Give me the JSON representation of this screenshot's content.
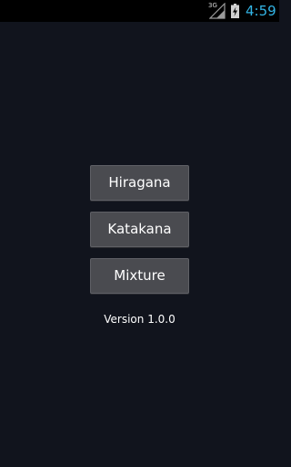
{
  "status_bar": {
    "network_type": "3G",
    "time": "4:59",
    "signal_icon": "signal-strength-icon",
    "battery_icon": "battery-charging-icon"
  },
  "menu": {
    "buttons": [
      {
        "label": "Hiragana"
      },
      {
        "label": "Katakana"
      },
      {
        "label": "Mixture"
      }
    ]
  },
  "version_text": "Version 1.0.0",
  "colors": {
    "background": "#11141d",
    "button_bg": "#4a4b50",
    "clock": "#33b5e5"
  }
}
